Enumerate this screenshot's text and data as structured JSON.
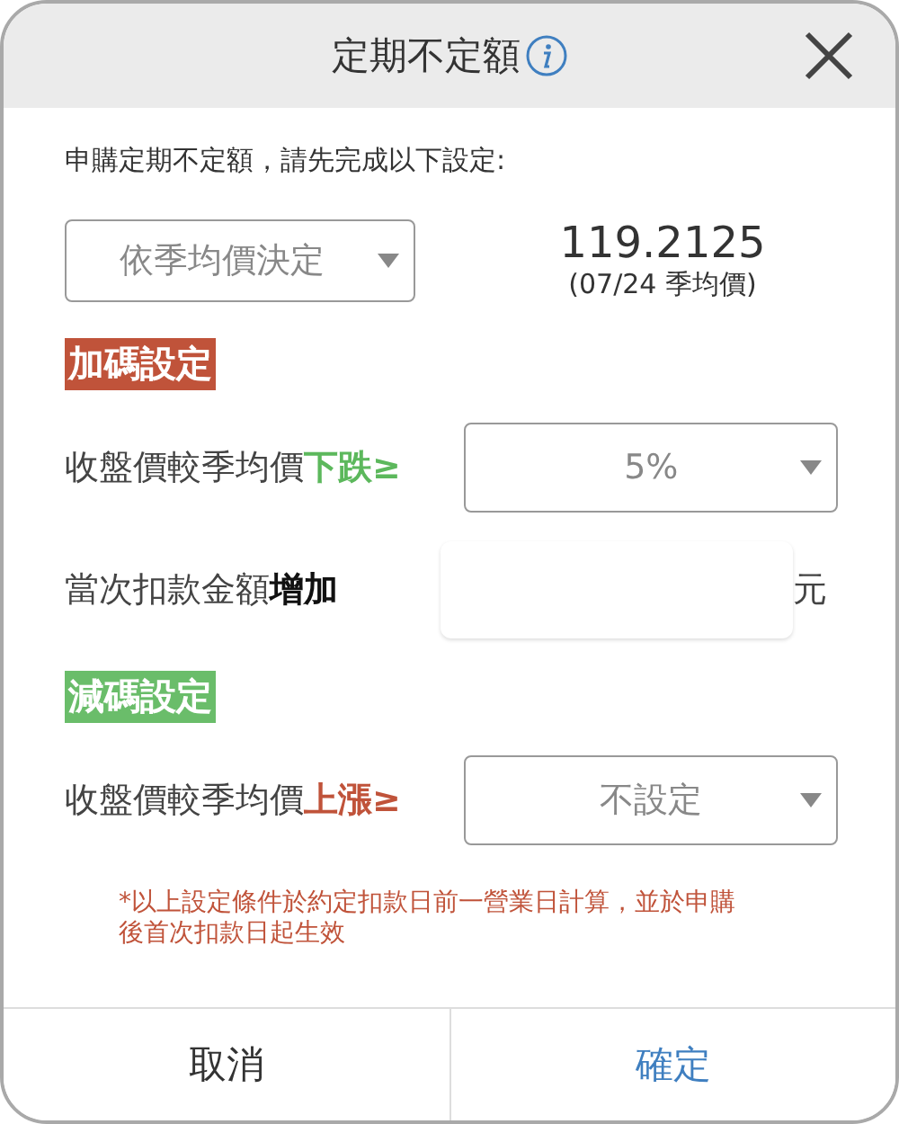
{
  "dialog": {
    "title": "定期不定額",
    "intro": "申購定期不定額，請先完成以下設定:",
    "basis": {
      "value": "依季均價決定"
    },
    "price": "119.2125",
    "price_note": "(07/24 季均價)",
    "sections": [
      {
        "heading": "加碼設定",
        "color": "#c0533a",
        "rows": [
          {
            "kind": "select",
            "label": "收盤價較季均價",
            "emphasis": "下跌≥",
            "color": "#5cb85c",
            "value": "5%"
          },
          {
            "kind": "input",
            "label": "當次扣款金額",
            "emphasis": "增加",
            "color": "#111111",
            "unit": "元"
          }
        ]
      },
      {
        "heading": "減碼設定",
        "color": "#6abd6a",
        "rows": [
          {
            "kind": "select",
            "label": "收盤價較季均價",
            "emphasis": "上漲≥",
            "color": "#c0533a",
            "value": "不設定"
          }
        ]
      }
    ],
    "note": "*以上設定條件於約定扣款日前一營業日計算，並於申購後首次扣款日起生效",
    "buttons": [
      {
        "label": "取消",
        "kind": "cancel"
      },
      {
        "label": "確定",
        "kind": "confirm"
      }
    ]
  }
}
